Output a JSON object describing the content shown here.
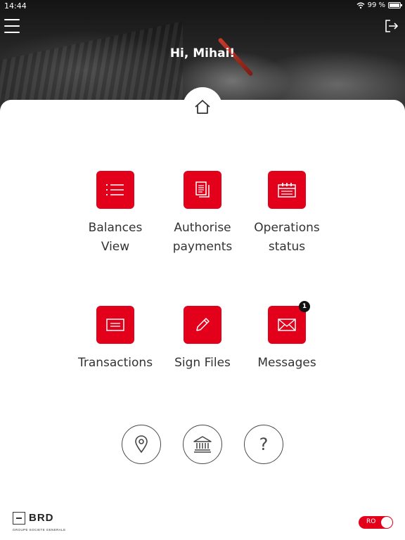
{
  "status_bar": {
    "time": "14:44",
    "battery": "99 %"
  },
  "header": {
    "greeting": "Hi, Mihai!"
  },
  "tiles": [
    {
      "label_line1": "Balances",
      "label_line2": "View",
      "icon": "list-icon"
    },
    {
      "label_line1": "Authorise",
      "label_line2": "payments",
      "icon": "document-stack-icon"
    },
    {
      "label_line1": "Operations",
      "label_line2": "status",
      "icon": "calendar-icon"
    },
    {
      "label_line1": "Transactions",
      "label_line2": "",
      "icon": "card-icon"
    },
    {
      "label_line1": "Sign Files",
      "label_line2": "",
      "icon": "pencil-icon"
    },
    {
      "label_line1": "Messages",
      "label_line2": "",
      "icon": "envelope-icon",
      "badge": "1"
    }
  ],
  "bottom_buttons": [
    {
      "icon": "location-pin-icon"
    },
    {
      "icon": "bank-icon"
    },
    {
      "icon": "question-icon",
      "text": "?"
    }
  ],
  "footer": {
    "logo_name": "BRD",
    "logo_sub": "GROUPE SOCIETE GENERALE",
    "language": "RO"
  },
  "colors": {
    "accent": "#e2001a",
    "text": "#333333"
  }
}
